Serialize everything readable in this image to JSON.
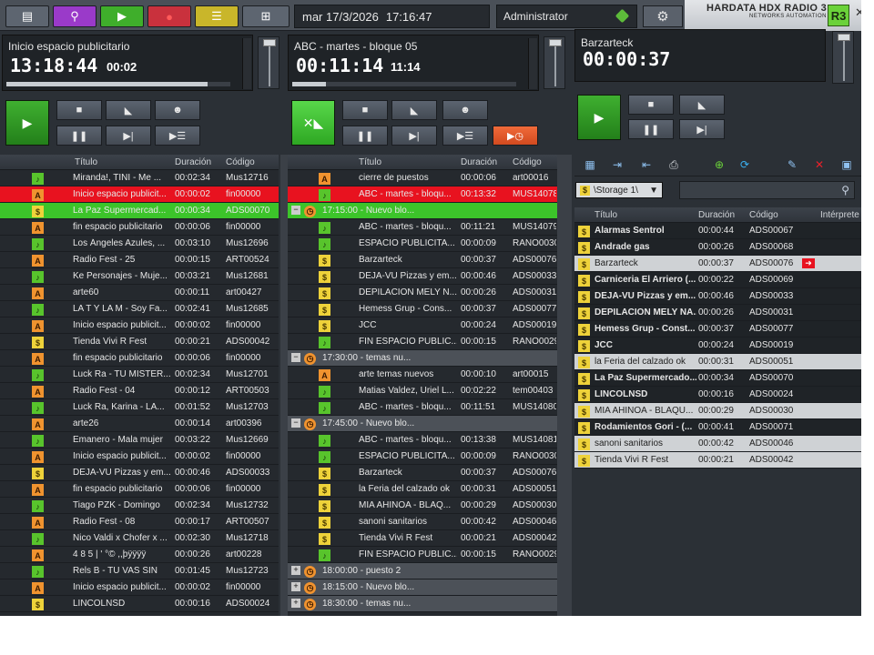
{
  "topbar": {
    "date": "mar 17/3/2026",
    "time": "17:16:47",
    "user": "Administrator",
    "brand_name": "HARDATA HDX RADIO 3",
    "brand_sub": "NETWORKS AUTOMATION",
    "logo": "R3",
    "close": "✕"
  },
  "players": [
    {
      "title": "Inicio espacio publicitario",
      "time": "13:18:44",
      "sub": "00:02",
      "progress": 0.9
    },
    {
      "title": "ABC - martes - bloque 05",
      "time": "00:11:14",
      "sub": "11:14",
      "progress": 0.15
    },
    {
      "title": "Barzarteck",
      "time": "00:00:37",
      "sub": "",
      "progress": 0
    }
  ],
  "columns": {
    "title": "Título",
    "duration": "Duración",
    "code": "Código",
    "performer": "Intérprete"
  },
  "list1": [
    {
      "t": "Miranda!, TINI - Me ...",
      "d": "00:02:34",
      "c": "Mus12716",
      "i": "m",
      "s": ""
    },
    {
      "t": "Inicio espacio publicit...",
      "d": "00:00:02",
      "c": "fin00000",
      "i": "a",
      "s": "red"
    },
    {
      "t": "La Paz Supermercad...",
      "d": "00:00:34",
      "c": "ADS00070",
      "i": "s",
      "s": "green"
    },
    {
      "t": "fin espacio publicitario",
      "d": "00:00:06",
      "c": "fin00000",
      "i": "a",
      "s": ""
    },
    {
      "t": "Los Ángeles Azules, ...",
      "d": "00:03:10",
      "c": "Mus12696",
      "i": "m",
      "s": ""
    },
    {
      "t": "Radio Fest - 25",
      "d": "00:00:15",
      "c": "ART00524",
      "i": "a",
      "s": ""
    },
    {
      "t": "Ke Personajes - Muje...",
      "d": "00:03:21",
      "c": "Mus12681",
      "i": "m",
      "s": ""
    },
    {
      "t": "arte60",
      "d": "00:00:11",
      "c": "art00427",
      "i": "a",
      "s": ""
    },
    {
      "t": "LA T Y LA M - Soy Fa...",
      "d": "00:02:41",
      "c": "Mus12685",
      "i": "m",
      "s": ""
    },
    {
      "t": "Inicio espacio publicit...",
      "d": "00:00:02",
      "c": "fin00000",
      "i": "a",
      "s": ""
    },
    {
      "t": "Tienda Vivi R Fest",
      "d": "00:00:21",
      "c": "ADS00042",
      "i": "s",
      "s": ""
    },
    {
      "t": "fin espacio publicitario",
      "d": "00:00:06",
      "c": "fin00000",
      "i": "a",
      "s": ""
    },
    {
      "t": "Luck Ra - TU MISTER...",
      "d": "00:02:34",
      "c": "Mus12701",
      "i": "m",
      "s": ""
    },
    {
      "t": "Radio Fest - 04",
      "d": "00:00:12",
      "c": "ART00503",
      "i": "a",
      "s": ""
    },
    {
      "t": "Luck Ra, Karina - LA...",
      "d": "00:01:52",
      "c": "Mus12703",
      "i": "m",
      "s": ""
    },
    {
      "t": "arte26",
      "d": "00:00:14",
      "c": "art00396",
      "i": "a",
      "s": ""
    },
    {
      "t": "Emanero - Mala mujer",
      "d": "00:03:22",
      "c": "Mus12669",
      "i": "m",
      "s": ""
    },
    {
      "t": "Inicio espacio publicit...",
      "d": "00:00:02",
      "c": "fin00000",
      "i": "a",
      "s": ""
    },
    {
      "t": "DEJA-VU Pizzas y em...",
      "d": "00:00:46",
      "c": "ADS00033",
      "i": "s",
      "s": ""
    },
    {
      "t": "fin espacio publicitario",
      "d": "00:00:06",
      "c": "fin00000",
      "i": "a",
      "s": ""
    },
    {
      "t": "Tiago PZK - Domingo",
      "d": "00:02:34",
      "c": "Mus12732",
      "i": "m",
      "s": ""
    },
    {
      "t": "Radio Fest - 08",
      "d": "00:00:17",
      "c": "ART00507",
      "i": "a",
      "s": ""
    },
    {
      "t": "Nico Valdi x Chofer x ...",
      "d": "00:02:30",
      "c": "Mus12718",
      "i": "m",
      "s": ""
    },
    {
      "t": "4 8 5 | ' °© ,,þÿÿÿÿ",
      "d": "00:00:26",
      "c": "art00228",
      "i": "a",
      "s": ""
    },
    {
      "t": "Rels B - TU VAS SIN",
      "d": "00:01:45",
      "c": "Mus12723",
      "i": "m",
      "s": ""
    },
    {
      "t": "Inicio espacio publicit...",
      "d": "00:00:02",
      "c": "fin00000",
      "i": "a",
      "s": ""
    },
    {
      "t": "LINCOLNSD",
      "d": "00:00:16",
      "c": "ADS00024",
      "i": "s",
      "s": ""
    }
  ],
  "list2": [
    {
      "t": "cierre de puestos",
      "d": "00:00:06",
      "c": "art00016",
      "i": "a",
      "s": "",
      "lv": 1
    },
    {
      "t": "ABC - martes - bloqu...",
      "d": "00:13:32",
      "c": "MUS14078",
      "i": "m",
      "s": "red",
      "lv": 1
    },
    {
      "t": "17:15:00 - Nuevo blo...",
      "d": "",
      "c": "",
      "i": "a",
      "s": "green",
      "lv": 0,
      "x": "−"
    },
    {
      "t": "ABC - martes - bloqu...",
      "d": "00:11:21",
      "c": "MUS14079",
      "i": "m",
      "s": "",
      "lv": 1
    },
    {
      "t": "ESPACIO PUBLICITA...",
      "d": "00:00:09",
      "c": "RANO0030",
      "i": "m",
      "s": "",
      "lv": 1
    },
    {
      "t": "Barzarteck",
      "d": "00:00:37",
      "c": "ADS00076",
      "i": "s",
      "s": "",
      "lv": 1
    },
    {
      "t": "DEJA-VU Pizzas y em...",
      "d": "00:00:46",
      "c": "ADS00033",
      "i": "s",
      "s": "",
      "lv": 1
    },
    {
      "t": "DEPILACION MELY N...",
      "d": "00:00:26",
      "c": "ADS00031",
      "i": "s",
      "s": "",
      "lv": 1
    },
    {
      "t": "Hemess Grup - Cons...",
      "d": "00:00:37",
      "c": "ADS00077",
      "i": "s",
      "s": "",
      "lv": 1
    },
    {
      "t": "JCC",
      "d": "00:00:24",
      "c": "ADS00019",
      "i": "s",
      "s": "",
      "lv": 1
    },
    {
      "t": "FIN ESPACIO PUBLIC...",
      "d": "00:00:15",
      "c": "RANO0029",
      "i": "m",
      "s": "",
      "lv": 1
    },
    {
      "t": "17:30:00 - temas nu...",
      "d": "",
      "c": "",
      "i": "a",
      "s": "block",
      "lv": 0,
      "x": "−"
    },
    {
      "t": "arte temas nuevos",
      "d": "00:00:10",
      "c": "art00015",
      "i": "a",
      "s": "",
      "lv": 1
    },
    {
      "t": "Matias Valdez, Uriel L...",
      "d": "00:02:22",
      "c": "tem00403",
      "i": "m",
      "s": "",
      "lv": 1
    },
    {
      "t": "ABC - martes - bloqu...",
      "d": "00:11:51",
      "c": "MUS14080",
      "i": "m",
      "s": "",
      "lv": 1
    },
    {
      "t": "17:45:00 - Nuevo blo...",
      "d": "",
      "c": "",
      "i": "a",
      "s": "block",
      "lv": 0,
      "x": "−"
    },
    {
      "t": "ABC - martes - bloqu...",
      "d": "00:13:38",
      "c": "MUS14081",
      "i": "m",
      "s": "",
      "lv": 1
    },
    {
      "t": "ESPACIO PUBLICITA...",
      "d": "00:00:09",
      "c": "RANO0030",
      "i": "m",
      "s": "",
      "lv": 1
    },
    {
      "t": "Barzarteck",
      "d": "00:00:37",
      "c": "ADS00076",
      "i": "s",
      "s": "",
      "lv": 1
    },
    {
      "t": "la Feria del calzado ok",
      "d": "00:00:31",
      "c": "ADS00051",
      "i": "s",
      "s": "",
      "lv": 1
    },
    {
      "t": "MIA AHINOA - BLAQ...",
      "d": "00:00:29",
      "c": "ADS00030",
      "i": "s",
      "s": "",
      "lv": 1
    },
    {
      "t": "sanoni sanitarios",
      "d": "00:00:42",
      "c": "ADS00046",
      "i": "s",
      "s": "",
      "lv": 1
    },
    {
      "t": "Tienda Vivi R Fest",
      "d": "00:00:21",
      "c": "ADS00042",
      "i": "s",
      "s": "",
      "lv": 1
    },
    {
      "t": "FIN ESPACIO PUBLIC...",
      "d": "00:00:15",
      "c": "RANO0029",
      "i": "m",
      "s": "",
      "lv": 1
    },
    {
      "t": "18:00:00 - puesto 2",
      "d": "",
      "c": "",
      "i": "a",
      "s": "block",
      "lv": 0,
      "x": "+"
    },
    {
      "t": "18:15:00 - Nuevo blo...",
      "d": "",
      "c": "",
      "i": "a",
      "s": "block",
      "lv": 0,
      "x": "+"
    },
    {
      "t": "18:30:00 - temas nu...",
      "d": "",
      "c": "",
      "i": "a",
      "s": "block",
      "lv": 0,
      "x": "+"
    }
  ],
  "storage": {
    "label": "\\Storage 1\\",
    "arrow": "▼"
  },
  "list3": [
    {
      "t": "Alarmas Sentrol",
      "d": "00:00:44",
      "c": "ADS00067",
      "s": "dark",
      "arr": false
    },
    {
      "t": "Andrade gas",
      "d": "00:00:26",
      "c": "ADS00068",
      "s": "dark",
      "arr": false
    },
    {
      "t": "Barzarteck",
      "d": "00:00:37",
      "c": "ADS00076",
      "s": "grey",
      "arr": true
    },
    {
      "t": "Carniceria El Arriero (...",
      "d": "00:00:22",
      "c": "ADS00069",
      "s": "dark",
      "arr": false
    },
    {
      "t": "DEJA-VU Pizzas y em...",
      "d": "00:00:46",
      "c": "ADS00033",
      "s": "dark",
      "arr": false
    },
    {
      "t": "DEPILACION MELY NA...",
      "d": "00:00:26",
      "c": "ADS00031",
      "s": "dark",
      "arr": false
    },
    {
      "t": "Hemess Grup - Const...",
      "d": "00:00:37",
      "c": "ADS00077",
      "s": "dark",
      "arr": false
    },
    {
      "t": "JCC",
      "d": "00:00:24",
      "c": "ADS00019",
      "s": "dark",
      "arr": false
    },
    {
      "t": "la Feria del calzado ok",
      "d": "00:00:31",
      "c": "ADS00051",
      "s": "grey",
      "arr": false
    },
    {
      "t": "La Paz Supermercado...",
      "d": "00:00:34",
      "c": "ADS00070",
      "s": "dark",
      "arr": false
    },
    {
      "t": "LINCOLNSD",
      "d": "00:00:16",
      "c": "ADS00024",
      "s": "dark",
      "arr": false
    },
    {
      "t": "MIA AHINOA - BLAQU...",
      "d": "00:00:29",
      "c": "ADS00030",
      "s": "grey",
      "arr": false
    },
    {
      "t": "Rodamientos Gori - (...",
      "d": "00:00:41",
      "c": "ADS00071",
      "s": "dark",
      "arr": false
    },
    {
      "t": "sanoni sanitarios",
      "d": "00:00:42",
      "c": "ADS00046",
      "s": "grey",
      "arr": false
    },
    {
      "t": "Tienda Vivi R Fest",
      "d": "00:00:21",
      "c": "ADS00042",
      "s": "grey",
      "arr": false
    }
  ],
  "icons": {
    "music": "♪",
    "ad": "$",
    "art": "A"
  }
}
